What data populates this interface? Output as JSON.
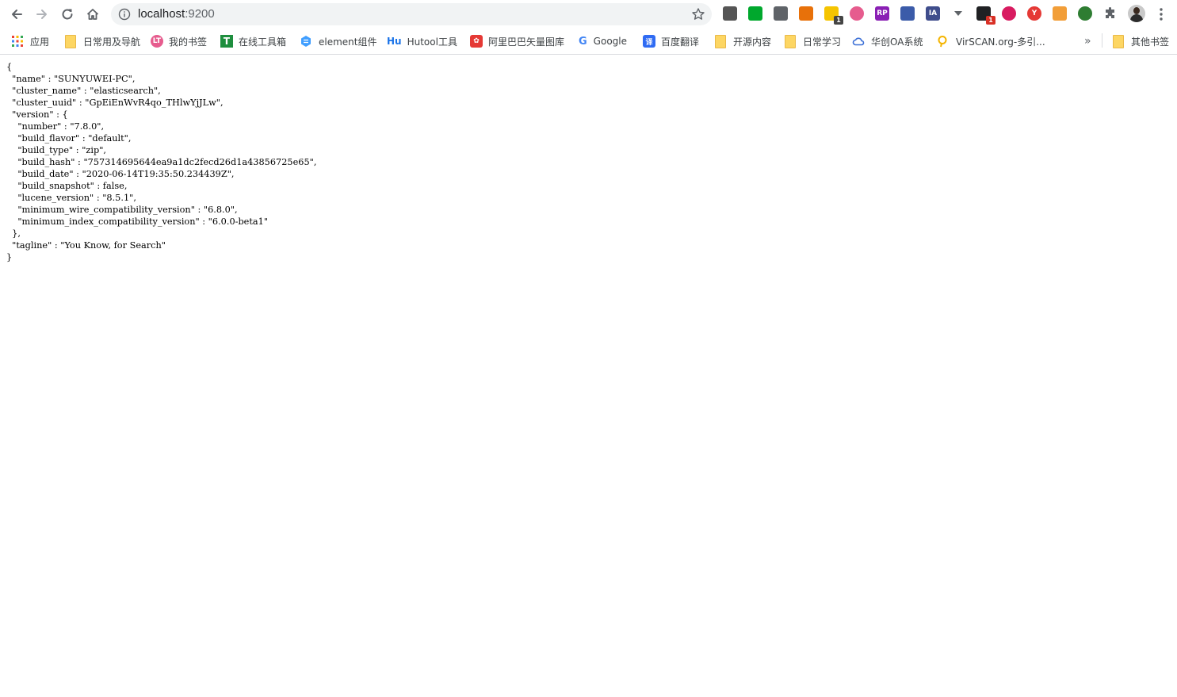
{
  "address_bar": {
    "host": "localhost",
    "port": ":9200"
  },
  "extensions": [
    {
      "name": "qr-code-extension-icon",
      "glyph": "",
      "color": "#555555"
    },
    {
      "name": "evernote-extension-icon",
      "glyph": "",
      "color": "#00a82d"
    },
    {
      "name": "shield-extension-icon",
      "glyph": "",
      "color": "#5f6368"
    },
    {
      "name": "sliders-extension-icon",
      "glyph": "",
      "color": "#e8710a"
    },
    {
      "name": "notes-extension-icon",
      "glyph": "",
      "color": "#f5c400",
      "badge": "1",
      "badge_color": "#444444"
    },
    {
      "name": "lt-extension-icon",
      "glyph": "",
      "color": "#e65c8e"
    },
    {
      "name": "rp-extension-icon",
      "glyph": "RP",
      "color": "#8a1fb4"
    },
    {
      "name": "window-extension-icon",
      "glyph": "",
      "color": "#3b5ba9"
    },
    {
      "name": "ia-extension-icon",
      "glyph": "IA",
      "color": "#3f4d8c"
    },
    {
      "name": "dropdown-extension-icon",
      "glyph": "",
      "color": "#5f6368"
    },
    {
      "name": "grid-extension-icon",
      "glyph": "",
      "color": "#202124",
      "badge": "1",
      "badge_color": "#d93025"
    },
    {
      "name": "moon-extension-icon",
      "glyph": "",
      "color": "#d81b60"
    },
    {
      "name": "y-extension-icon",
      "glyph": "Y",
      "color": "#e53935"
    },
    {
      "name": "box-extension-icon",
      "glyph": "",
      "color": "#f29e38"
    },
    {
      "name": "world-extension-icon",
      "glyph": "",
      "color": "#2e7d32"
    },
    {
      "name": "puzzle-extension-icon",
      "glyph": "",
      "color": "#5f6368"
    }
  ],
  "bookmarks": [
    {
      "label": "应用",
      "icon": "apps-grid-icon"
    },
    {
      "label": "日常用及导航",
      "icon": "folder-icon"
    },
    {
      "label": "我的书签",
      "icon": "lt-icon",
      "color": "#e65c8e"
    },
    {
      "label": "在线工具箱",
      "icon": "t-icon",
      "color": "#1e8e3e"
    },
    {
      "label": "element组件",
      "icon": "element-icon",
      "color": "#409eff"
    },
    {
      "label": "Hutool工具",
      "icon": "hu-icon",
      "color": "#1a73e8"
    },
    {
      "label": "阿里巴巴矢量图库",
      "icon": "iconfont-icon",
      "color": "#e53935"
    },
    {
      "label": "Google",
      "icon": "google-icon"
    },
    {
      "label": "百度翻译",
      "icon": "baidu-translate-icon",
      "color": "#2f6bf3"
    },
    {
      "label": "开源内容",
      "icon": "folder-icon"
    },
    {
      "label": "日常学习",
      "icon": "folder-icon"
    },
    {
      "label": "华创OA系统",
      "icon": "cloud-icon",
      "color": "#3b6fd6"
    },
    {
      "label": "VirSCAN.org-多引...",
      "icon": "virscan-icon",
      "color": "#f4b400"
    }
  ],
  "other_bookmarks": {
    "label": "其他书签"
  },
  "json_lines": [
    "{",
    "  \"name\" : \"SUNYUWEI-PC\",",
    "  \"cluster_name\" : \"elasticsearch\",",
    "  \"cluster_uuid\" : \"GpEiEnWvR4qo_THlwYjJLw\",",
    "  \"version\" : {",
    "    \"number\" : \"7.8.0\",",
    "    \"build_flavor\" : \"default\",",
    "    \"build_type\" : \"zip\",",
    "    \"build_hash\" : \"757314695644ea9a1dc2fecd26d1a43856725e65\",",
    "    \"build_date\" : \"2020-06-14T19:35:50.234439Z\",",
    "    \"build_snapshot\" : false,",
    "    \"lucene_version\" : \"8.5.1\",",
    "    \"minimum_wire_compatibility_version\" : \"6.8.0\",",
    "    \"minimum_index_compatibility_version\" : \"6.0.0-beta1\"",
    "  },",
    "  \"tagline\" : \"You Know, for Search\"",
    "}"
  ]
}
